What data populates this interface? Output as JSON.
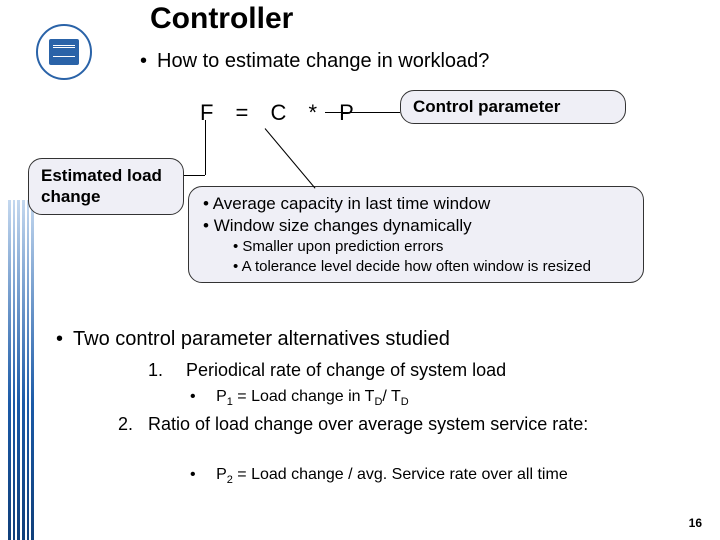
{
  "title": "Controller",
  "question": "How to estimate change in workload?",
  "formula": "F = C * P",
  "estimated_label": "Estimated load change",
  "control_label": "Control parameter",
  "capacity": {
    "l1a": "Average capacity in last time window",
    "l1b": "Window size changes dynamically",
    "l2a": "Smaller upon prediction errors",
    "l2b": "A tolerance level decide how often window is resized"
  },
  "alt_heading": "Two control parameter alternatives studied",
  "alt1": {
    "num": "1.",
    "text": "Periodical rate of change of system load",
    "sub_prefix": "P",
    "sub_sub": "1",
    "sub_body": " = Load change in T",
    "sub_body2": "/ T"
  },
  "alt2": {
    "num": "2.",
    "text": "Ratio of load change over average system service rate:",
    "sub_prefix": "P",
    "sub_sub": "2",
    "sub_body": " = Load change / avg. Service rate over all time"
  },
  "slide_number": "16"
}
